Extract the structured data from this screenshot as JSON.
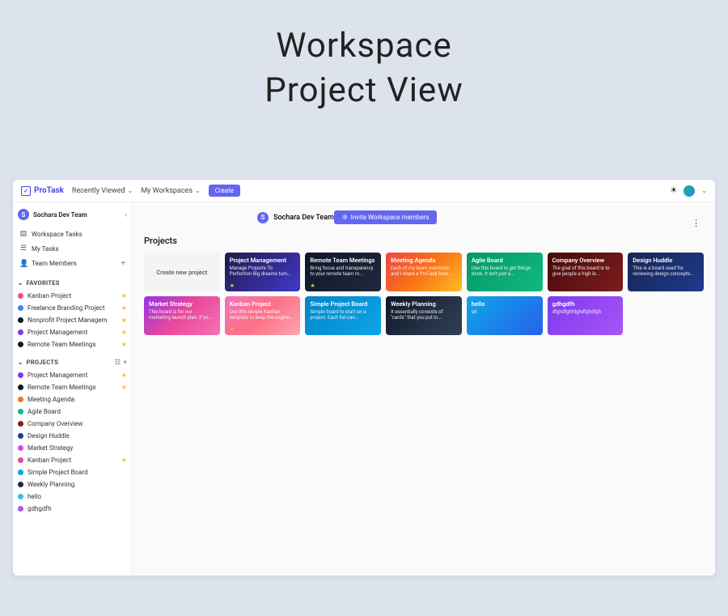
{
  "page": {
    "title_line1": "Workspace",
    "title_line2": "Project View"
  },
  "topbar": {
    "logo": "ProTask",
    "nav": {
      "recent": "Recently Viewed",
      "workspaces": "My Workspaces"
    },
    "create": "Create"
  },
  "sidebar": {
    "team_initial": "S",
    "team_name": "Sochara Dev Team",
    "nav": {
      "workspace_tasks": "Workspace Tasks",
      "my_tasks": "My Tasks",
      "team_members": "Team Members"
    },
    "favorites_label": "FAVORITES",
    "favorites": [
      {
        "label": "Kanban Project",
        "color": "#ec4899",
        "star": true
      },
      {
        "label": "Freelance Branding Project",
        "color": "#3b82f6",
        "star": true
      },
      {
        "label": "Nonprofit Project Managem",
        "color": "#0f172a",
        "star": true
      },
      {
        "label": "Project Management",
        "color": "#7c3aed",
        "star": true
      },
      {
        "label": "Remote Team Meetings",
        "color": "#0f172a",
        "star": true
      }
    ],
    "projects_label": "PROJECTS",
    "projects": [
      {
        "label": "Project Management",
        "color": "#7c3aed",
        "star": true
      },
      {
        "label": "Remote Team Meetings",
        "color": "#0f172a",
        "star": true
      },
      {
        "label": "Meeting Agenda",
        "color": "#f97316",
        "star": false
      },
      {
        "label": "Agile Board",
        "color": "#10b981",
        "star": false
      },
      {
        "label": "Company Overview",
        "color": "#7f1d1d",
        "star": false
      },
      {
        "label": "Design Huddle",
        "color": "#1e3a8a",
        "star": false
      },
      {
        "label": "Market Strategy",
        "color": "#d946ef",
        "star": false
      },
      {
        "label": "Kanban Project",
        "color": "#ec4899",
        "star": true
      },
      {
        "label": "Simple Project Board",
        "color": "#0ea5e9",
        "star": false
      },
      {
        "label": "Weekly Planning",
        "color": "#1e293b",
        "star": false
      },
      {
        "label": "hello",
        "color": "#38bdf8",
        "star": false
      },
      {
        "label": "gdhgdfh",
        "color": "#a855f7",
        "star": false
      }
    ]
  },
  "main": {
    "team_initial": "S",
    "team_name": "Sochara Dev Team",
    "invite_label": "Invite Workspace members",
    "projects_heading": "Projects",
    "create_card": "Create new project",
    "cards": [
      {
        "title": "Project Management",
        "desc": "Manage Projects To Perfection Big dreams turn int...",
        "star": true,
        "bg": "linear-gradient(135deg,#1e1b4b,#4338ca)"
      },
      {
        "title": "Remote Team Meetings",
        "desc": "Bring focus and transparency to your remote team m...",
        "star": true,
        "bg": "linear-gradient(135deg,#0f172a,#1e293b)"
      },
      {
        "title": "Meeting Agenda",
        "desc": "Each of my team members and I share a ProTask boar...",
        "star": false,
        "bg": "linear-gradient(135deg,#ef4444,#f97316,#fbbf24)"
      },
      {
        "title": "Agile Board",
        "desc": "Use this board to get things done. It isn't just a...",
        "star": false,
        "bg": "linear-gradient(135deg,#059669,#10b981)"
      },
      {
        "title": "Company Overview",
        "desc": "The goal of this board is to give people a high le...",
        "star": false,
        "bg": "linear-gradient(135deg,#450a0a,#7f1d1d)"
      },
      {
        "title": "Design Huddle",
        "desc": "This is a board used for reviewing design concepts...",
        "star": false,
        "bg": "linear-gradient(135deg,#172554,#1e3a8a)"
      },
      {
        "title": "Market Strategy",
        "desc": "This board is for our marketing launch plan. If yo...",
        "star": false,
        "bg": "linear-gradient(135deg,#9333ea,#ec4899,#f472b6)"
      },
      {
        "title": "Kanban Project",
        "desc": "Use this simple Kanban template to keep the engine...",
        "star": true,
        "bg": "linear-gradient(135deg,#f472b6,#fb7185,#fda4af)"
      },
      {
        "title": "Simple Project Board",
        "desc": "Simple board to start on a project. Each list can...",
        "star": false,
        "bg": "linear-gradient(135deg,#0284c7,#0ea5e9)"
      },
      {
        "title": "Weekly Planning",
        "desc": "It essentially consists of \"cards\" that you put in...",
        "star": false,
        "bg": "linear-gradient(135deg,#0f172a,#334155)"
      },
      {
        "title": "hello",
        "desc": "sd",
        "star": false,
        "bg": "linear-gradient(135deg,#0ea5e9,#2563eb)"
      },
      {
        "title": "gdhgdfh",
        "desc": "dfghdfghfdghdfghdfgh",
        "star": false,
        "bg": "linear-gradient(135deg,#7c3aed,#a855f7)"
      }
    ]
  }
}
